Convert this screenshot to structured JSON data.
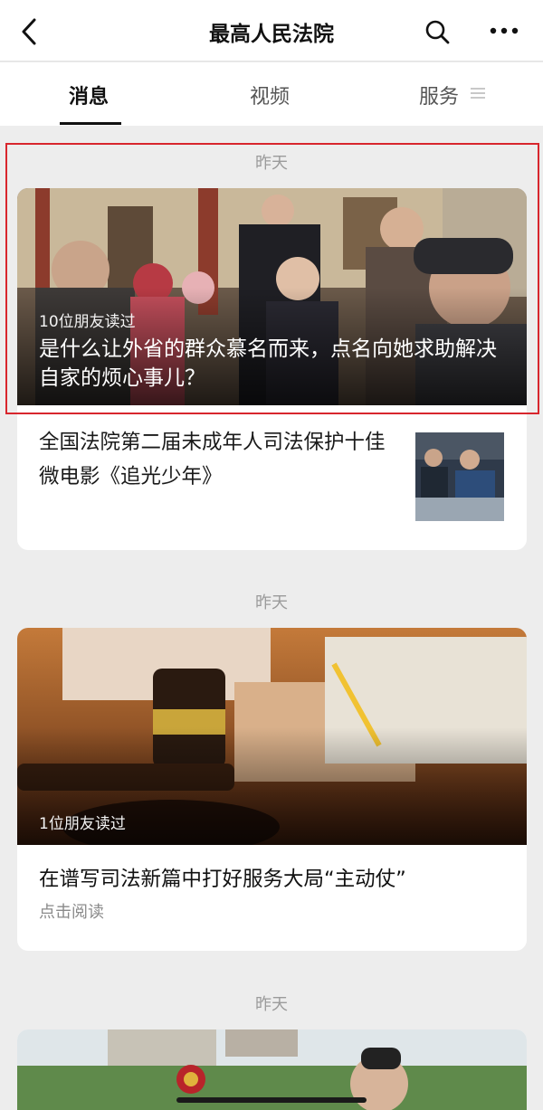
{
  "header": {
    "title": "最高人民法院",
    "back_icon": "chevron-left-icon",
    "search_icon": "search-icon",
    "more_icon": "more-horizontal-icon"
  },
  "tabs": [
    {
      "label": "消息",
      "active": true
    },
    {
      "label": "视频",
      "active": false
    },
    {
      "label": "服务",
      "active": false,
      "icon": "menu-lines-icon"
    }
  ],
  "feed": [
    {
      "timestamp": "昨天",
      "cover": {
        "read_count": "10位朋友读过",
        "title": "是什么让外省的群众慕名而来，点名向她求助解决自家的烦心事儿？"
      },
      "sub_items": [
        {
          "title": "全国法院第二届未成年人司法保护十佳微电影《追光少年》"
        }
      ]
    },
    {
      "timestamp": "昨天",
      "cover": {
        "read_count": "1位朋友读过"
      },
      "title": "在谱写司法新篇中打好服务大局“主动仗”",
      "hint": "点击阅读"
    },
    {
      "timestamp": "昨天"
    }
  ],
  "colors": {
    "background": "#ededed",
    "card": "#ffffff",
    "highlight_border": "#d8262d"
  }
}
